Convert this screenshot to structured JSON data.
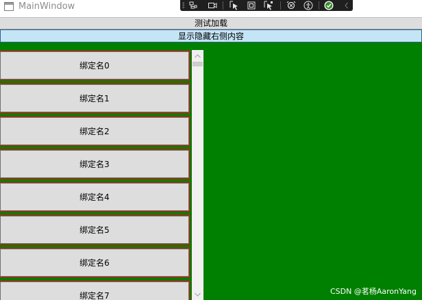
{
  "window": {
    "title": "MainWindow",
    "icon": "window-icon"
  },
  "debug_toolbar": {
    "icons": [
      "go-to-live-visual-tree-icon",
      "show-in-app-toolbar-icon",
      "select-element-icon",
      "display-layout-adorners-icon",
      "track-focus-icon",
      "hot-reload-icon",
      "accessibility-icon",
      "binding-check-icon",
      "collapse-chevron-icon"
    ]
  },
  "test_bar": {
    "label": "测试加载"
  },
  "toggle_bar": {
    "label": "显示隐藏右侧内容"
  },
  "content": {
    "background": "#008000",
    "item_border_color": "#8b3a10"
  },
  "items": [
    {
      "label": "绑定名0"
    },
    {
      "label": "绑定名1"
    },
    {
      "label": "绑定名2"
    },
    {
      "label": "绑定名3"
    },
    {
      "label": "绑定名4"
    },
    {
      "label": "绑定名5"
    },
    {
      "label": "绑定名6"
    },
    {
      "label": "绑定名7"
    }
  ],
  "watermark": {
    "text": "CSDN @茗杨AaronYang"
  }
}
